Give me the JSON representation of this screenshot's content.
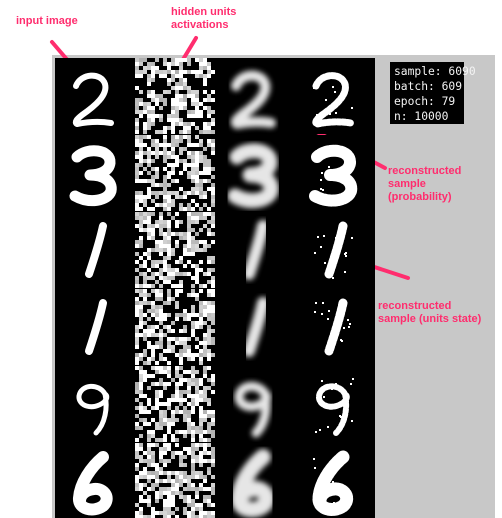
{
  "annotations": {
    "input_image": "input image",
    "hidden_units": "hidden units\nactivations",
    "reconstructed_probability": "reconstructed\nsample\n(probability)",
    "reconstructed_state": "reconstructed\nsample (units state)"
  },
  "status": {
    "sample": "sample: 6090",
    "batch": "batch: 609",
    "epoch": "epoch: 79",
    "n": "n: 10000"
  },
  "digits": [
    "2",
    "3",
    "1",
    "1",
    "9",
    "6"
  ],
  "columns": [
    "input-image",
    "hidden-activations",
    "reconstructed-probability",
    "reconstructed-state"
  ],
  "colors": {
    "annotation": "#ff2d6e",
    "panel": "#c8c8c8",
    "cell_background": "#000000",
    "stroke": "#ffffff"
  }
}
